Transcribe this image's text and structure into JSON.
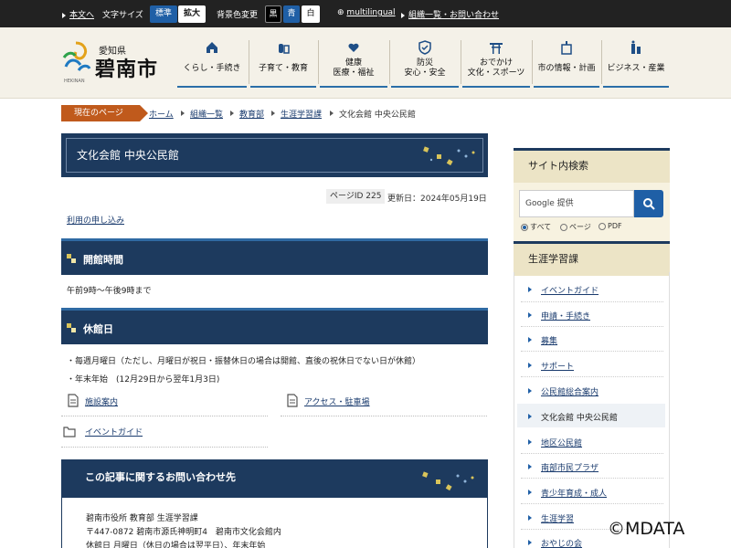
{
  "topbar": {
    "skip_label": "本文へ",
    "text_size_label": "文字サイズ",
    "text_size_standard": "標準",
    "text_size_large": "拡大",
    "bg_color_label": "背景色変更",
    "bg_black": "黒",
    "bg_blue": "青",
    "bg_white": "白",
    "multilingual": "multilingual",
    "org_contact": "組織一覧・お問い合わせ"
  },
  "logo": {
    "pref": "愛知県",
    "city": "碧南市",
    "en": "HEKINAN"
  },
  "nav": [
    {
      "label": "くらし・手続き",
      "icon": "house-icon"
    },
    {
      "label": "子育て・教育",
      "icon": "baby-bottle-icon"
    },
    {
      "label": "健康\n医療・福祉",
      "icon": "heart-hand-icon"
    },
    {
      "label": "防災\n安心・安全",
      "icon": "shield-icon"
    },
    {
      "label": "おでかけ\n文化・スポーツ",
      "icon": "shrine-icon"
    },
    {
      "label": "市の情報・計画",
      "icon": "city-hall-icon"
    },
    {
      "label": "ビジネス・産業",
      "icon": "business-icon"
    }
  ],
  "breadcrumb": {
    "current_tag": "現在のページ",
    "items": [
      "ホーム",
      "組織一覧",
      "教育部",
      "生涯学習課"
    ],
    "current": "文化会館 中央公民館"
  },
  "page": {
    "title": "文化会館 中央公民館",
    "page_id_label": "ページID 225",
    "updated": "更新日：2024年05月19日",
    "apply_link": "利用の申し込み",
    "hours_heading": "開館時間",
    "hours_text": "午前9時～午後9時まで",
    "closed_heading": "休館日",
    "closed_lines": [
      "・毎週月曜日（ただし、月曜日が祝日・振替休日の場合は開館、直後の祝休日でない日が休館）",
      "・年末年始　(12月29日から翌年1月3日)"
    ],
    "doc_links": [
      "施設案内",
      "アクセス・駐車場"
    ],
    "folder_link": "イベントガイド",
    "contact_heading": "この記事に関するお問い合わせ先",
    "contact_lines": [
      "碧南市役所 教育部 生涯学習課",
      "〒447-0872 碧南市源氏神明町4　碧南市文化会館内",
      "休館日 月曜日（休日の場合は翌平日）、年末年始"
    ]
  },
  "sidebar": {
    "search_heading": "サイト内検索",
    "search_placeholder": "Google 提供",
    "radio_all": "すべて",
    "radio_page": "ページ",
    "radio_pdf": "PDF",
    "section_heading": "生涯学習課",
    "items": [
      "イベントガイド",
      "申請・手続き",
      "募集",
      "サポート",
      "公民館総合案内",
      "文化会館 中央公民館",
      "地区公民館",
      "南部市民プラザ",
      "青少年育成・成人",
      "生涯学習",
      "おやじの会"
    ]
  },
  "watermark": "©MDATA",
  "colors": {
    "navy": "#1d3a5e",
    "accent_blue": "#1f5fa6",
    "breadcrumb_orange": "#c05a1c",
    "header_bg": "#f4f1e8",
    "sidebar_beige": "#ece4c6"
  }
}
